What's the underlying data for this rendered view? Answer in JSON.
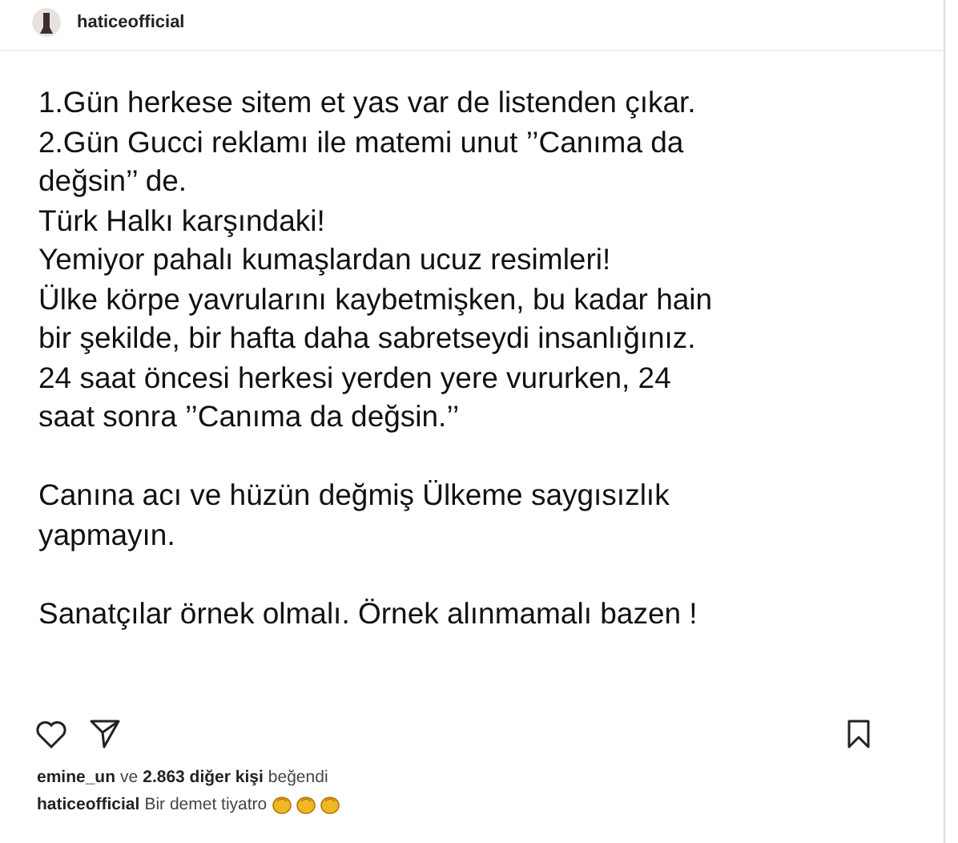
{
  "header": {
    "username": "haticeofficial"
  },
  "post_text": [
    [
      "1.Gün herkese sitem et yas var de listenden çıkar.",
      "2.Gün Gucci reklamı ile matemi unut ’’Canıma da",
      "değsin’’ de.",
      "Türk Halkı karşındaki!",
      "Yemiyor pahalı kumaşlardan ucuz resimleri!",
      "Ülke körpe yavrularını kaybetmişken, bu kadar hain",
      "bir şekilde, bir hafta daha sabretseydi insanlığınız.",
      "24 saat öncesi herkesi yerden yere vururken, 24",
      "saat sonra ’’Canıma da değsin.’’"
    ],
    [
      "Canına acı ve hüzün değmiş Ülkeme saygısızlık",
      "yapmayın."
    ],
    [
      "Sanatçılar örnek olmalı. Örnek alınmamalı bazen !"
    ]
  ],
  "likes": {
    "user": "emine_un",
    "middle": "ve",
    "count": "2.863 diğer kişi",
    "verb": "beğendi"
  },
  "caption": {
    "user": "haticeofficial",
    "text": "Bir demet tiyatro"
  }
}
